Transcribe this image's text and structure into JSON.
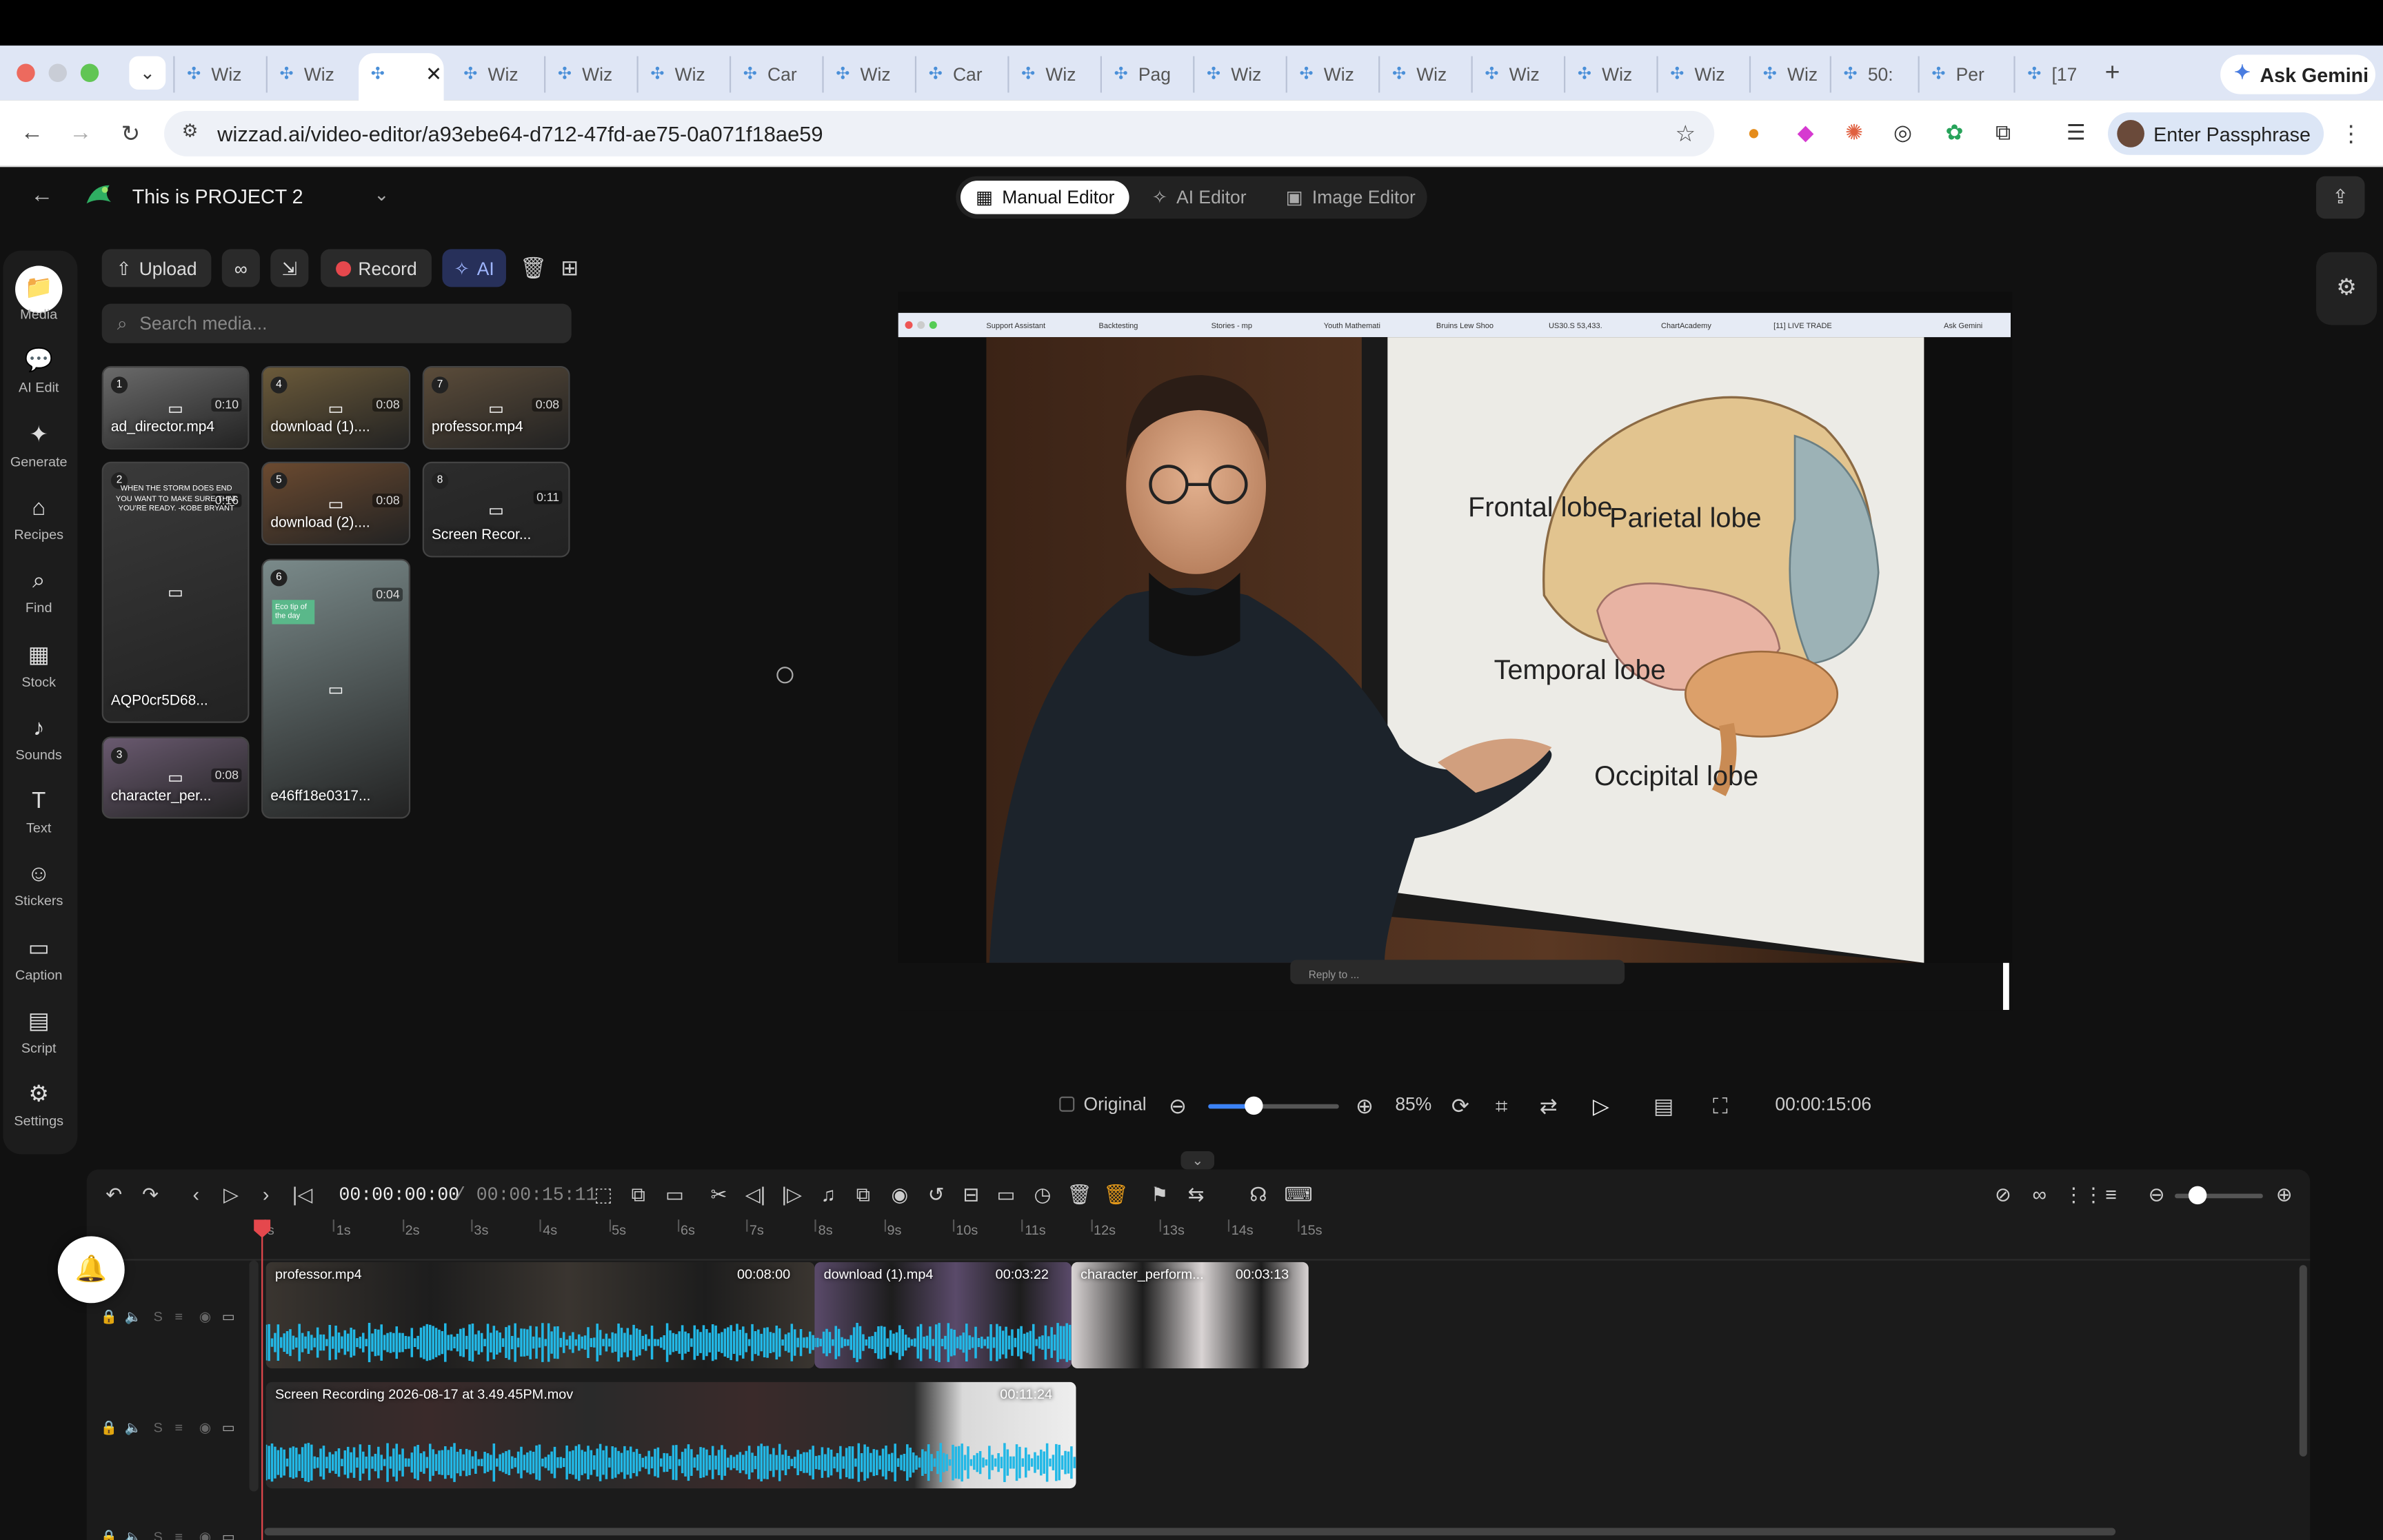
{
  "browser": {
    "tabs": [
      "Wiz",
      "Wiz",
      "",
      "Wiz",
      "Wiz",
      "Wiz",
      "Car",
      "Wiz",
      "Car",
      "Wiz",
      "Pag",
      "Wiz",
      "Wiz",
      "Wiz",
      "Wiz",
      "Wiz",
      "Wiz",
      "Wiz",
      "50:",
      "Per",
      "[17"
    ],
    "ask_gemini": "Ask Gemini",
    "url": "wizzad.ai/video-editor/a93ebe64-d712-47fd-ae75-0a071f18ae59",
    "passphrase": "Enter Passphrase"
  },
  "project": {
    "title": "This is PROJECT 2"
  },
  "modes": {
    "manual": "Manual Editor",
    "ai": "AI Editor",
    "image": "Image Editor"
  },
  "sidebar": {
    "items": [
      {
        "label": "Media"
      },
      {
        "label": "AI Edit"
      },
      {
        "label": "Generate"
      },
      {
        "label": "Recipes"
      },
      {
        "label": "Find"
      },
      {
        "label": "Stock"
      },
      {
        "label": "Sounds"
      },
      {
        "label": "Text"
      },
      {
        "label": "Stickers"
      },
      {
        "label": "Caption"
      },
      {
        "label": "Script"
      },
      {
        "label": "Settings"
      }
    ]
  },
  "media_toolbar": {
    "upload": "Upload",
    "record": "Record",
    "ai": "AI"
  },
  "search": {
    "placeholder": "Search media..."
  },
  "media": [
    {
      "no": "1",
      "name": "ad_director.mp4",
      "dur": "0:10"
    },
    {
      "no": "4",
      "name": "download (1)....",
      "dur": "0:08"
    },
    {
      "no": "7",
      "name": "professor.mp4",
      "dur": "0:08"
    },
    {
      "no": "2",
      "name": "AQP0cr5D68...",
      "dur": "0:16",
      "quote": "WHEN THE STORM DOES END YOU WANT TO MAKE SURE THAT YOU'RE READY. -KOBE BRYANT"
    },
    {
      "no": "5",
      "name": "download (2)....",
      "dur": "0:08"
    },
    {
      "no": "8",
      "name": "Screen Recor...",
      "dur": "0:11"
    },
    {
      "no": "6",
      "name": "e46ff18e0317...",
      "dur": "0:04",
      "sticker": "Eco tip of the day"
    },
    {
      "no": "3",
      "name": "character_per...",
      "dur": "0:08"
    }
  ],
  "preview": {
    "labels": {
      "frontal": "Frontal lobe",
      "parietal": "Parietal lobe",
      "temporal": "Temporal lobe",
      "occipital": "Occipital lobe"
    },
    "inner_tabs": [
      "Support Assistant",
      "Backtesting",
      "Stories - mp",
      "Youth Mathemati",
      "Bruins Lew Shoo",
      "US30.S 53,433.",
      "ChartAcademy",
      "[11] LIVE TRADE",
      "Ask Gemini"
    ],
    "caption": "Reply to ..."
  },
  "player": {
    "original": "Original",
    "zoom": "85%",
    "zoom_level": 0.35,
    "time": "00:00:15:06"
  },
  "timeline": {
    "current": "00:00:00:00",
    "total": "/ 00:00:15:11",
    "ruler": [
      "s",
      "1s",
      "2s",
      "3s",
      "4s",
      "5s",
      "6s",
      "7s",
      "8s",
      "9s",
      "10s",
      "11s",
      "12s",
      "13s",
      "14s",
      "15s"
    ],
    "track1": [
      {
        "name": "professor.mp4",
        "dur": "00:08:00"
      },
      {
        "name": "download (1).mp4",
        "dur": "00:03:22"
      },
      {
        "name": "character_perform...",
        "dur": "00:03:13"
      }
    ],
    "track2": [
      {
        "name": "Screen Recording 2026-08-17 at 3.49.45PM.mov",
        "dur": "00:11:24"
      }
    ],
    "track_label": "S"
  },
  "colors": {
    "accent": "#3b82f6",
    "record": "#e5484d",
    "wave": "#22b8e6",
    "playhead": "#e5484d"
  }
}
